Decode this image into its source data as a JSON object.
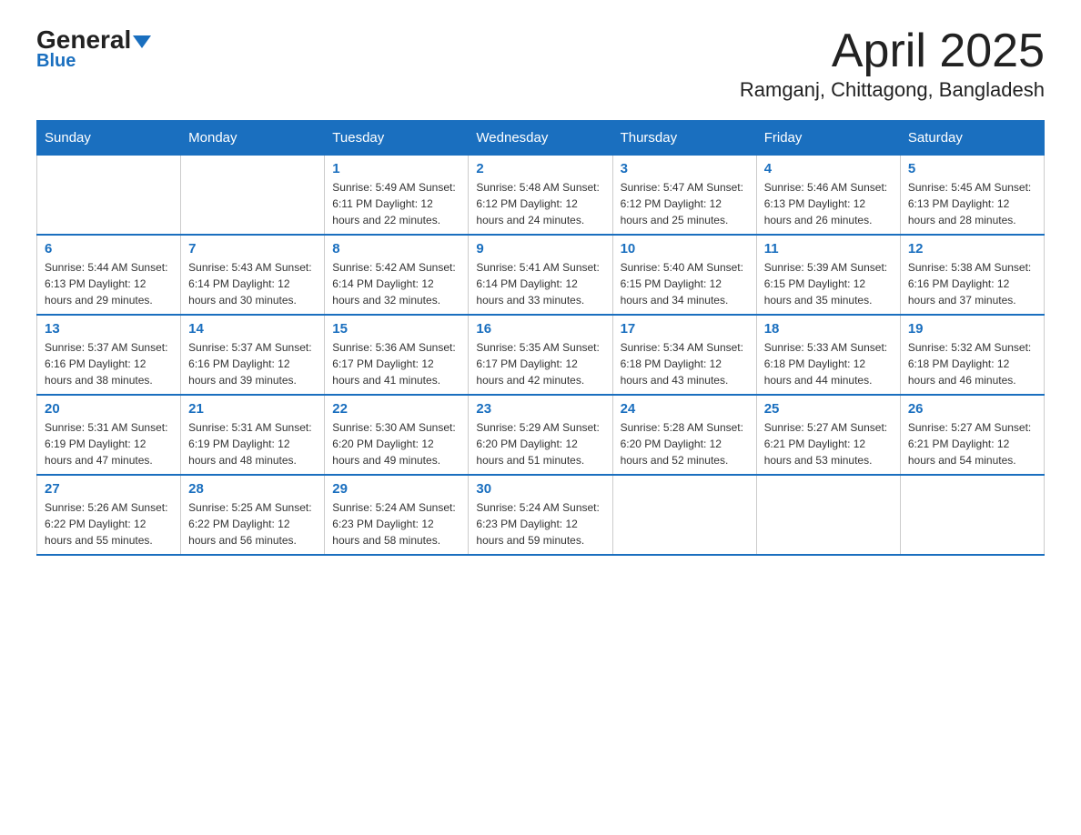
{
  "header": {
    "logo_general": "General",
    "logo_blue": "Blue",
    "month_title": "April 2025",
    "location": "Ramganj, Chittagong, Bangladesh"
  },
  "weekdays": [
    "Sunday",
    "Monday",
    "Tuesday",
    "Wednesday",
    "Thursday",
    "Friday",
    "Saturday"
  ],
  "weeks": [
    [
      {
        "day": "",
        "info": ""
      },
      {
        "day": "",
        "info": ""
      },
      {
        "day": "1",
        "info": "Sunrise: 5:49 AM\nSunset: 6:11 PM\nDaylight: 12 hours\nand 22 minutes."
      },
      {
        "day": "2",
        "info": "Sunrise: 5:48 AM\nSunset: 6:12 PM\nDaylight: 12 hours\nand 24 minutes."
      },
      {
        "day": "3",
        "info": "Sunrise: 5:47 AM\nSunset: 6:12 PM\nDaylight: 12 hours\nand 25 minutes."
      },
      {
        "day": "4",
        "info": "Sunrise: 5:46 AM\nSunset: 6:13 PM\nDaylight: 12 hours\nand 26 minutes."
      },
      {
        "day": "5",
        "info": "Sunrise: 5:45 AM\nSunset: 6:13 PM\nDaylight: 12 hours\nand 28 minutes."
      }
    ],
    [
      {
        "day": "6",
        "info": "Sunrise: 5:44 AM\nSunset: 6:13 PM\nDaylight: 12 hours\nand 29 minutes."
      },
      {
        "day": "7",
        "info": "Sunrise: 5:43 AM\nSunset: 6:14 PM\nDaylight: 12 hours\nand 30 minutes."
      },
      {
        "day": "8",
        "info": "Sunrise: 5:42 AM\nSunset: 6:14 PM\nDaylight: 12 hours\nand 32 minutes."
      },
      {
        "day": "9",
        "info": "Sunrise: 5:41 AM\nSunset: 6:14 PM\nDaylight: 12 hours\nand 33 minutes."
      },
      {
        "day": "10",
        "info": "Sunrise: 5:40 AM\nSunset: 6:15 PM\nDaylight: 12 hours\nand 34 minutes."
      },
      {
        "day": "11",
        "info": "Sunrise: 5:39 AM\nSunset: 6:15 PM\nDaylight: 12 hours\nand 35 minutes."
      },
      {
        "day": "12",
        "info": "Sunrise: 5:38 AM\nSunset: 6:16 PM\nDaylight: 12 hours\nand 37 minutes."
      }
    ],
    [
      {
        "day": "13",
        "info": "Sunrise: 5:37 AM\nSunset: 6:16 PM\nDaylight: 12 hours\nand 38 minutes."
      },
      {
        "day": "14",
        "info": "Sunrise: 5:37 AM\nSunset: 6:16 PM\nDaylight: 12 hours\nand 39 minutes."
      },
      {
        "day": "15",
        "info": "Sunrise: 5:36 AM\nSunset: 6:17 PM\nDaylight: 12 hours\nand 41 minutes."
      },
      {
        "day": "16",
        "info": "Sunrise: 5:35 AM\nSunset: 6:17 PM\nDaylight: 12 hours\nand 42 minutes."
      },
      {
        "day": "17",
        "info": "Sunrise: 5:34 AM\nSunset: 6:18 PM\nDaylight: 12 hours\nand 43 minutes."
      },
      {
        "day": "18",
        "info": "Sunrise: 5:33 AM\nSunset: 6:18 PM\nDaylight: 12 hours\nand 44 minutes."
      },
      {
        "day": "19",
        "info": "Sunrise: 5:32 AM\nSunset: 6:18 PM\nDaylight: 12 hours\nand 46 minutes."
      }
    ],
    [
      {
        "day": "20",
        "info": "Sunrise: 5:31 AM\nSunset: 6:19 PM\nDaylight: 12 hours\nand 47 minutes."
      },
      {
        "day": "21",
        "info": "Sunrise: 5:31 AM\nSunset: 6:19 PM\nDaylight: 12 hours\nand 48 minutes."
      },
      {
        "day": "22",
        "info": "Sunrise: 5:30 AM\nSunset: 6:20 PM\nDaylight: 12 hours\nand 49 minutes."
      },
      {
        "day": "23",
        "info": "Sunrise: 5:29 AM\nSunset: 6:20 PM\nDaylight: 12 hours\nand 51 minutes."
      },
      {
        "day": "24",
        "info": "Sunrise: 5:28 AM\nSunset: 6:20 PM\nDaylight: 12 hours\nand 52 minutes."
      },
      {
        "day": "25",
        "info": "Sunrise: 5:27 AM\nSunset: 6:21 PM\nDaylight: 12 hours\nand 53 minutes."
      },
      {
        "day": "26",
        "info": "Sunrise: 5:27 AM\nSunset: 6:21 PM\nDaylight: 12 hours\nand 54 minutes."
      }
    ],
    [
      {
        "day": "27",
        "info": "Sunrise: 5:26 AM\nSunset: 6:22 PM\nDaylight: 12 hours\nand 55 minutes."
      },
      {
        "day": "28",
        "info": "Sunrise: 5:25 AM\nSunset: 6:22 PM\nDaylight: 12 hours\nand 56 minutes."
      },
      {
        "day": "29",
        "info": "Sunrise: 5:24 AM\nSunset: 6:23 PM\nDaylight: 12 hours\nand 58 minutes."
      },
      {
        "day": "30",
        "info": "Sunrise: 5:24 AM\nSunset: 6:23 PM\nDaylight: 12 hours\nand 59 minutes."
      },
      {
        "day": "",
        "info": ""
      },
      {
        "day": "",
        "info": ""
      },
      {
        "day": "",
        "info": ""
      }
    ]
  ]
}
